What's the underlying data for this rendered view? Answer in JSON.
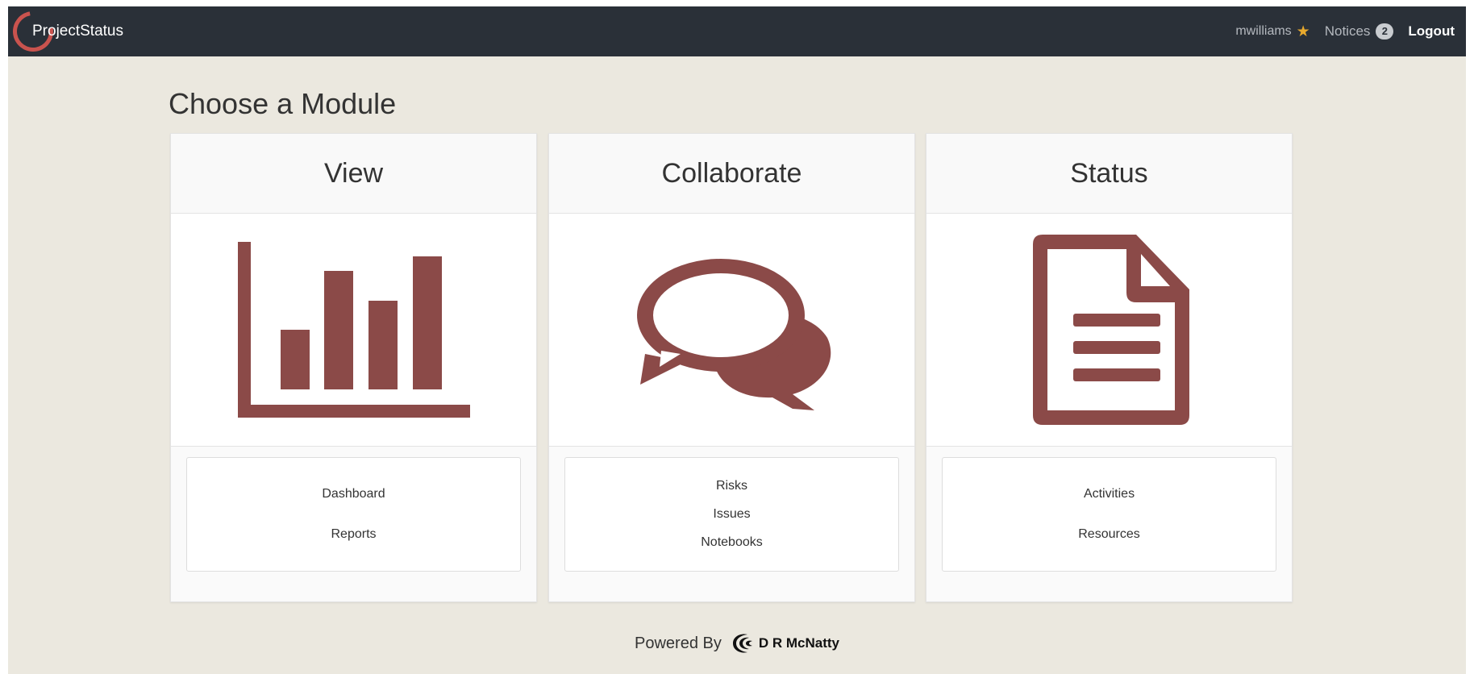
{
  "navbar": {
    "brand": "ProjectStatus",
    "username": "mwilliams",
    "user_icon": "star-icon",
    "notices_label": "Notices",
    "notices_count": "2",
    "logout_label": "Logout"
  },
  "page": {
    "heading": "Choose a Module"
  },
  "modules": [
    {
      "title": "View",
      "icon": "bar-chart-icon",
      "links": [
        "Dashboard",
        "Reports"
      ]
    },
    {
      "title": "Collaborate",
      "icon": "chat-bubbles-icon",
      "links": [
        "Risks",
        "Issues",
        "Notebooks"
      ]
    },
    {
      "title": "Status",
      "icon": "document-icon",
      "links": [
        "Activities",
        "Resources"
      ]
    }
  ],
  "footer": {
    "powered_by": "Powered By",
    "logo_text": "D R McNatty"
  },
  "colors": {
    "navbar_bg": "#2a3038",
    "page_bg": "#ebe8df",
    "icon": "#8b4a48",
    "brand_ring": "#c9534e",
    "star": "#e8a92d"
  }
}
